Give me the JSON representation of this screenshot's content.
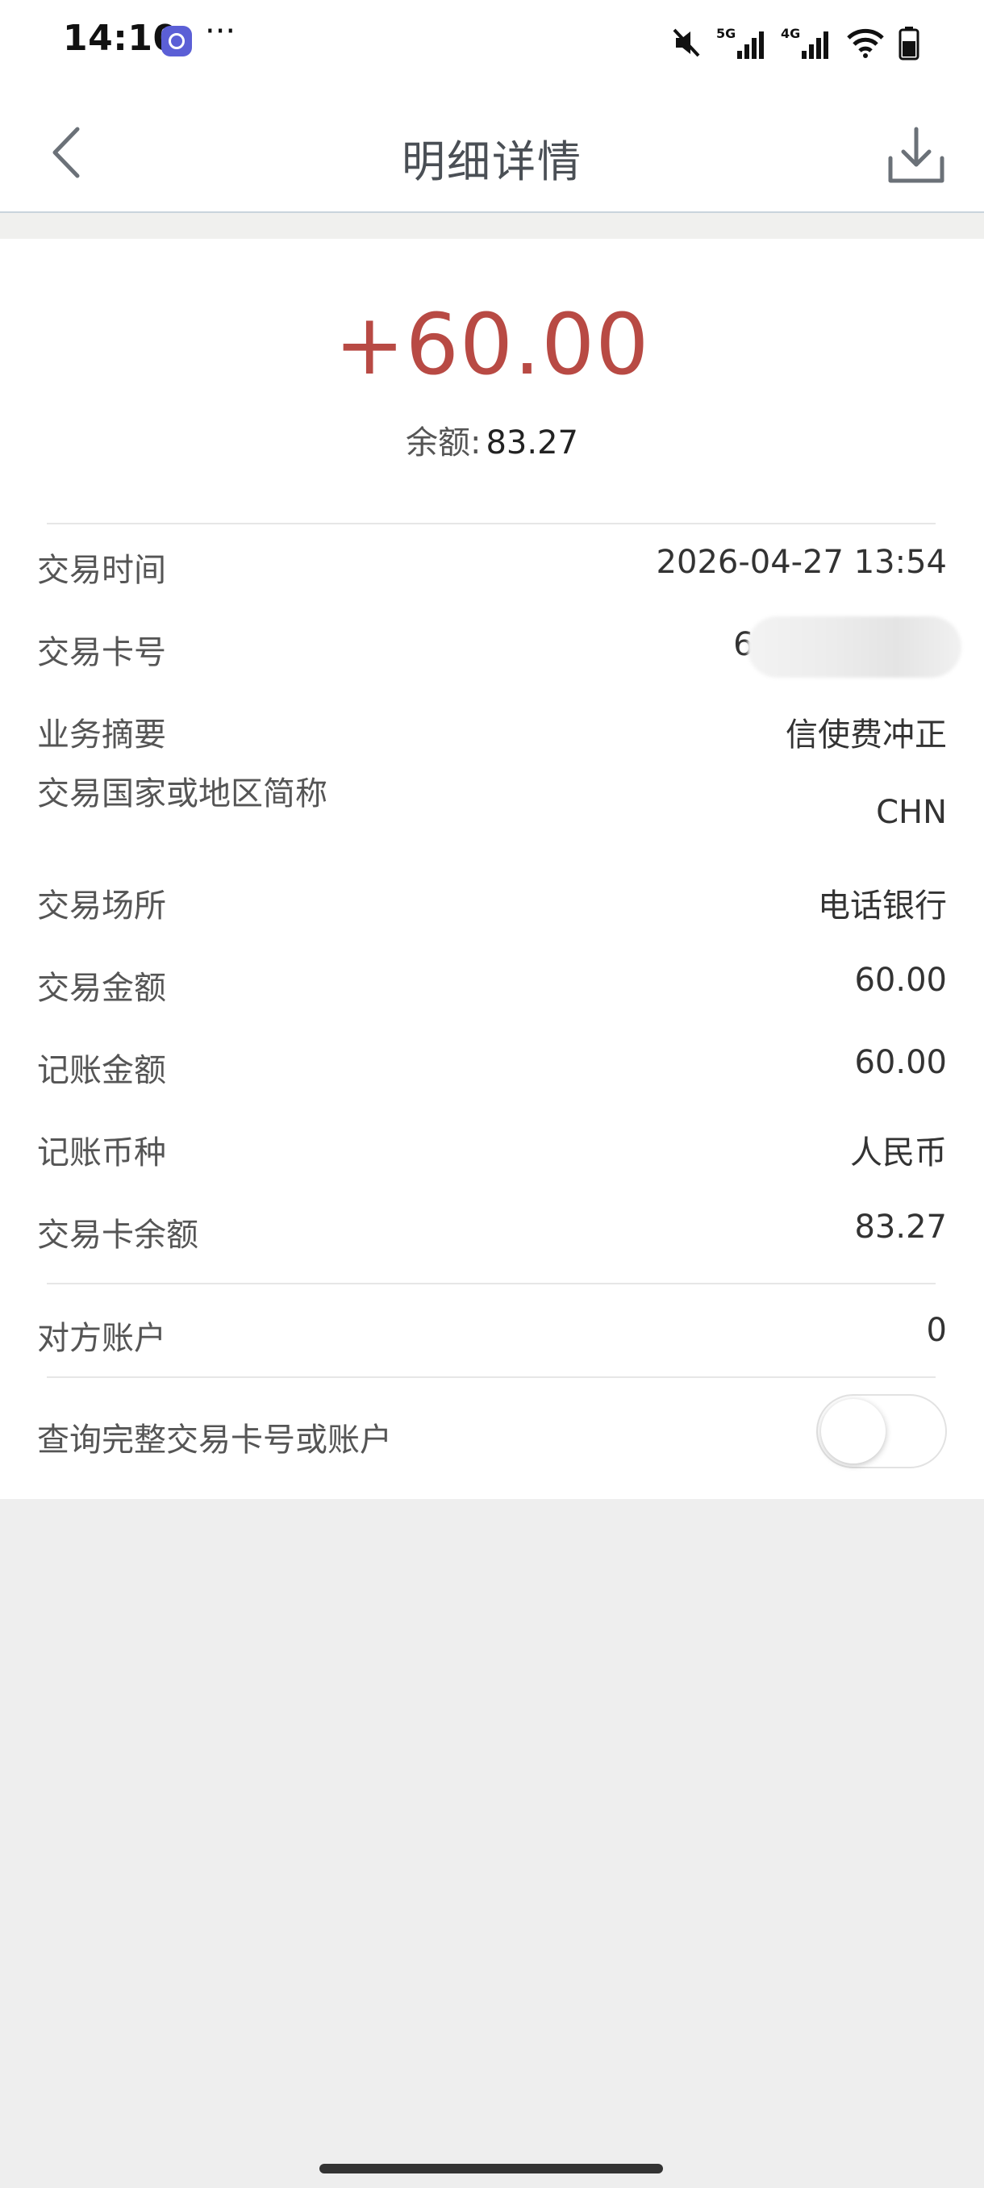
{
  "status_bar": {
    "time": "14:10",
    "more": "···",
    "icons": [
      "mute-icon",
      "signal-5g-icon",
      "signal-4g-icon",
      "wifi-icon",
      "battery-icon"
    ],
    "network_labels": {
      "first": "5G",
      "second": "4G"
    }
  },
  "nav": {
    "title": "明细详情",
    "back_icon": "chevron-left-icon",
    "download_icon": "download-icon"
  },
  "summary": {
    "amount": "+60.00",
    "balance_label": "余额:",
    "balance_value": "83.27"
  },
  "details": [
    {
      "label": "交易时间",
      "value": "2026-04-27 13:54"
    },
    {
      "label": "交易卡号",
      "value": "62"
    },
    {
      "label": "业务摘要",
      "value": "信使费冲正"
    },
    {
      "label": "交易国家或地区简称",
      "value": "CHN"
    },
    {
      "label": "交易场所",
      "value": "电话银行"
    },
    {
      "label": "交易金额",
      "value": "60.00"
    },
    {
      "label": "记账金额",
      "value": "60.00"
    },
    {
      "label": "记账币种",
      "value": "人民币"
    },
    {
      "label": "交易卡余额",
      "value": "83.27"
    }
  ],
  "counterparty": {
    "label": "对方账户",
    "value": "0"
  },
  "query_full": {
    "label": "查询完整交易卡号或账户",
    "toggle_on": false
  },
  "colors": {
    "amount": "#b84a44",
    "background": "#eeeeee",
    "card": "#ffffff",
    "title": "#4a4f55"
  }
}
